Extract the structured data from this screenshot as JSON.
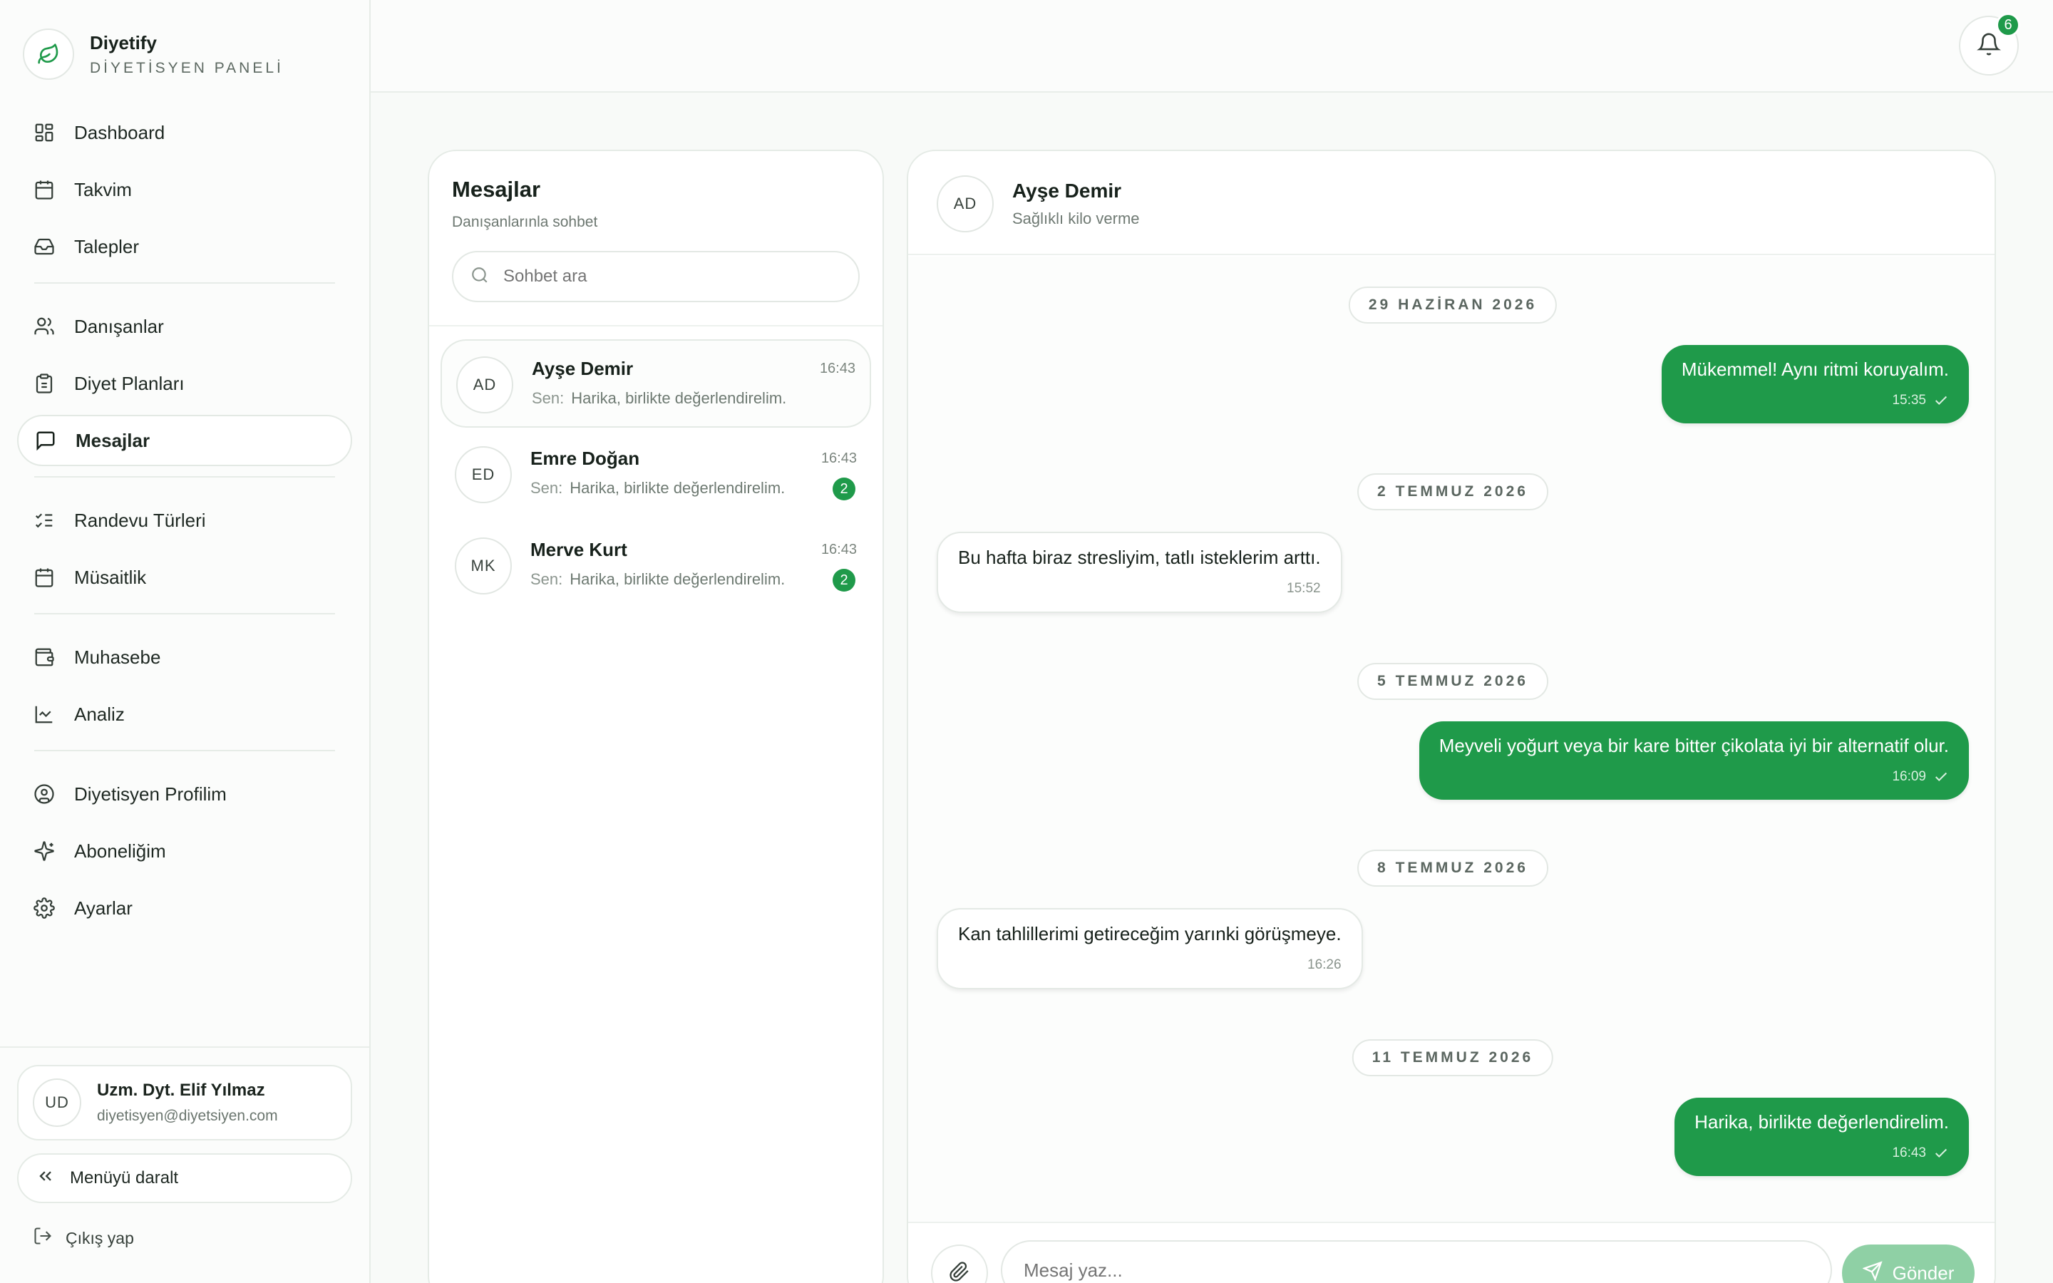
{
  "brand": {
    "name": "Diyetify",
    "subtitle": "DİYETİSYEN PANELİ"
  },
  "nav": {
    "dashboard": "Dashboard",
    "calendar": "Takvim",
    "requests": "Talepler",
    "clients": "Danışanlar",
    "diet_plans": "Diyet Planları",
    "messages": "Mesajlar",
    "appointment_types": "Randevu Türleri",
    "availability": "Müsaitlik",
    "accounting": "Muhasebe",
    "analysis": "Analiz",
    "profile": "Diyetisyen Profilim",
    "subscription": "Aboneliğim",
    "settings": "Ayarlar"
  },
  "user": {
    "initials": "UD",
    "name": "Uzm. Dyt. Elif Yılmaz",
    "email": "diyetisyen@diyetsiyen.com"
  },
  "collapse_label": "Menüyü daralt",
  "logout_label": "Çıkış yap",
  "notifications": {
    "count": "6"
  },
  "conversations": {
    "title": "Mesajlar",
    "subtitle": "Danışanlarınla sohbet",
    "search_placeholder": "Sohbet ara",
    "sender_prefix": "Sen:",
    "items": [
      {
        "initials": "AD",
        "name": "Ayşe Demir",
        "time": "16:43",
        "preview": "Harika, birlikte değerlendirelim.",
        "unread": ""
      },
      {
        "initials": "ED",
        "name": "Emre Doğan",
        "time": "16:43",
        "preview": "Harika, birlikte değerlendirelim.",
        "unread": "2"
      },
      {
        "initials": "MK",
        "name": "Merve Kurt",
        "time": "16:43",
        "preview": "Harika, birlikte değerlendirelim.",
        "unread": "2"
      }
    ]
  },
  "chat": {
    "initials": "AD",
    "name": "Ayşe Demir",
    "goal": "Sağlıklı kilo verme",
    "dates": [
      "29 HAZİRAN 2026",
      "2 TEMMUZ 2026",
      "5 TEMMUZ 2026",
      "8 TEMMUZ 2026",
      "11 TEMMUZ 2026"
    ],
    "messages": [
      {
        "direction": "out",
        "text": "Mükemmel! Aynı ritmi koruyalım.",
        "time": "15:35"
      },
      {
        "direction": "in",
        "text": "Bu hafta biraz stresliyim, tatlı isteklerim arttı.",
        "time": "15:52"
      },
      {
        "direction": "out",
        "text": "Meyveli yoğurt veya bir kare bitter çikolata iyi bir alternatif olur.",
        "time": "16:09"
      },
      {
        "direction": "in",
        "text": "Kan tahlillerimi getireceğim yarınki görüşmeye.",
        "time": "16:26"
      },
      {
        "direction": "out",
        "text": "Harika, birlikte değerlendirelim.",
        "time": "16:43"
      }
    ],
    "input_placeholder": "Mesaj yaz...",
    "send_label": "Gönder"
  },
  "colors": {
    "accent": "#1f9a4a",
    "accent_disabled": "#8fd0a5",
    "background": "#f8faf8"
  }
}
